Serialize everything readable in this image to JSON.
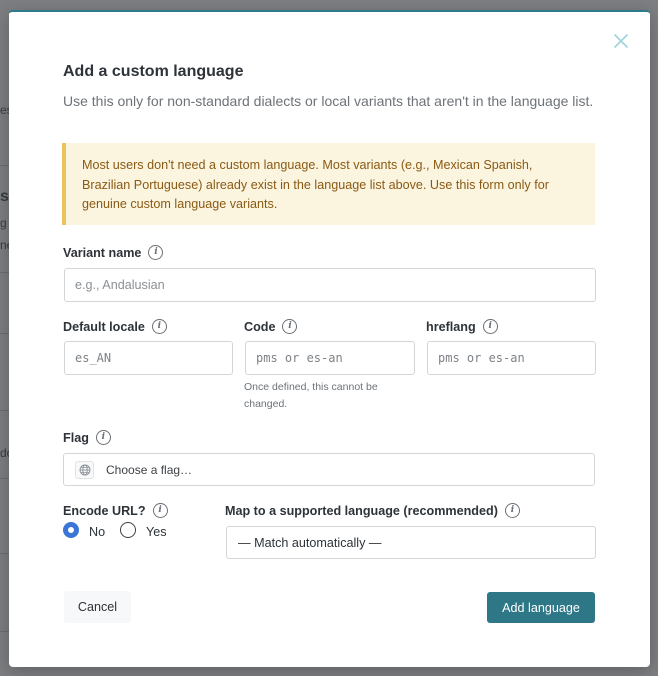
{
  "background": {
    "fragments": [
      "es",
      "s",
      "g",
      "ne",
      "do"
    ]
  },
  "modal": {
    "title": "Add a custom language",
    "subtitle": "Use this only for non-standard dialects or local variants that aren't in the language list.",
    "notice": "Most users don't need a custom language. Most variants (e.g., Mexican Spanish, Brazilian Portuguese) already exist in the language list above. Use this form only for genuine custom language variants.",
    "variant_name": {
      "label": "Variant name",
      "placeholder": "e.g., Andalusian",
      "value": ""
    },
    "default_locale": {
      "label": "Default locale",
      "placeholder": "es_AN",
      "value": ""
    },
    "code": {
      "label": "Code",
      "placeholder": "pms or es-an",
      "value": "",
      "hint": "Once defined, this cannot be changed."
    },
    "hreflang": {
      "label": "hreflang",
      "placeholder": "pms or es-an",
      "value": ""
    },
    "flag": {
      "label": "Flag",
      "value": "Choose a flag…",
      "icon": "globe-icon"
    },
    "encode_url": {
      "label": "Encode URL?",
      "options": [
        "No",
        "Yes"
      ],
      "selected": "No"
    },
    "map_language": {
      "label": "Map to a supported language (recommended)",
      "value": "— Match automatically —"
    },
    "buttons": {
      "cancel": "Cancel",
      "add": "Add language"
    },
    "info_icon_glyph": "i"
  },
  "colors": {
    "accent": "#2e7787",
    "notice_bg": "#fbf4df",
    "notice_border": "#ecc35a",
    "notice_text": "#8a5a14",
    "radio_selected": "#3b76d6"
  }
}
